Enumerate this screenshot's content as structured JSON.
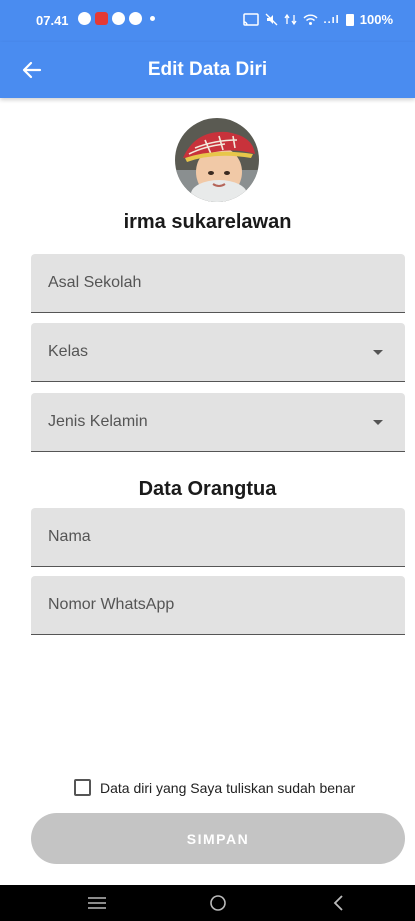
{
  "status_bar": {
    "time": "07.41",
    "signal": "..ıl",
    "battery": "100%",
    "icons": [
      "chat-icon",
      "notification-icon",
      "help-icon",
      "app-icon",
      "dot-icon",
      "cast-icon",
      "mute-icon",
      "data-icon",
      "wifi-icon",
      "signal-icon",
      "battery-icon"
    ]
  },
  "app_bar": {
    "title": "Edit Data Diri",
    "back_icon": "arrow-left-icon",
    "color": "#4a8cf0"
  },
  "profile": {
    "name": "irma sukarelawan"
  },
  "form": {
    "asal_sekolah": {
      "placeholder": "Asal Sekolah"
    },
    "kelas": {
      "placeholder": "Kelas"
    },
    "jenis_kelamin": {
      "placeholder": "Jenis Kelamin"
    },
    "section_title": "Data Orangtua",
    "nama": {
      "placeholder": "Nama"
    },
    "nomor_whatsapp": {
      "placeholder": "Nomor WhatsApp"
    },
    "confirm_label": "Data diri yang Saya tuliskan sudah benar",
    "confirm_checked": false,
    "submit_label": "SIMPAN"
  },
  "nav_bar": {
    "buttons": [
      "menu-icon",
      "home-icon",
      "back-icon"
    ]
  }
}
